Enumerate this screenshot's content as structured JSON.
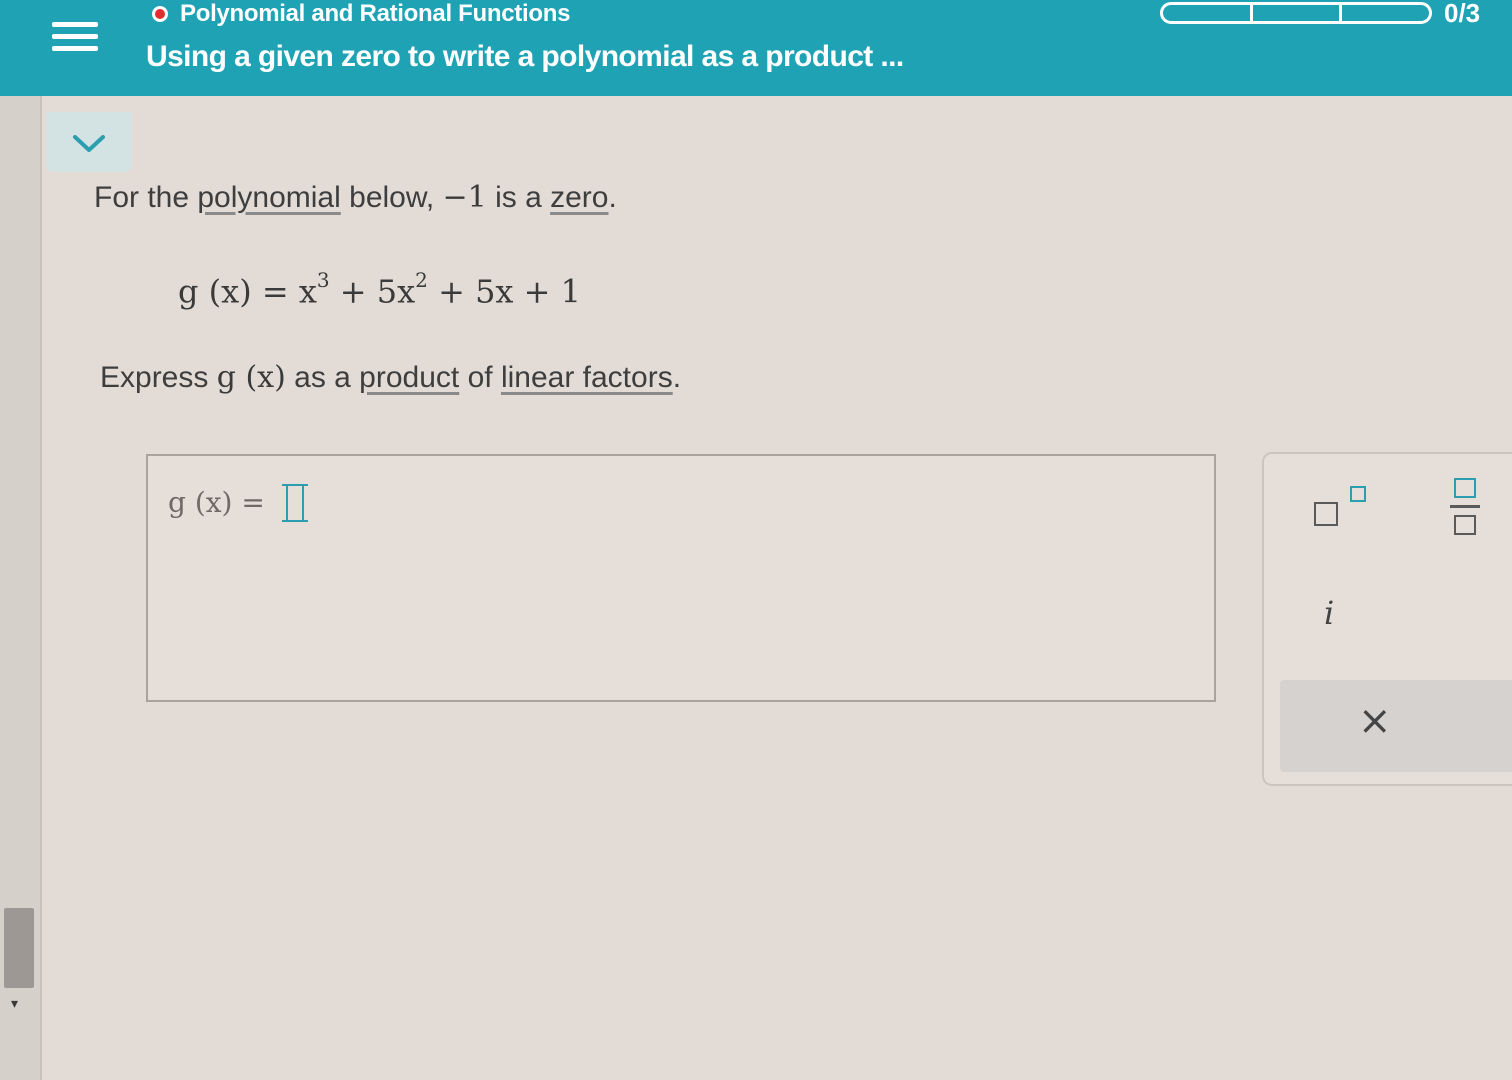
{
  "header": {
    "topic": "Polynomial and Rational Functions",
    "lesson": "Using a given zero to write a polynomial as a product ...",
    "score": "0/3",
    "progress_segments": 3
  },
  "question": {
    "intro_pre": "For the ",
    "intro_link1": "polynomial",
    "intro_mid": " below, ",
    "zero_value": "−1",
    "intro_is_a": " is a ",
    "intro_link2": "zero",
    "intro_end": ".",
    "equation_lhs": "g (x) = x",
    "exp3": "3",
    "term2": "+ 5x",
    "exp2": "2",
    "term3": "+ 5x + 1",
    "instr_pre": "Express ",
    "instr_fn": "g (x)",
    "instr_as_a": " as a ",
    "instr_link1": "product",
    "instr_of": " of ",
    "instr_link2": "linear factors",
    "instr_end": "."
  },
  "answer": {
    "label": "g (x)  =",
    "value": ""
  },
  "keypad": {
    "imag_key": "i",
    "clear_key": "×"
  },
  "colors": {
    "header_bg": "#1fa3b4",
    "accent": "#2b9fb0",
    "status_dot": "#e02d2d"
  },
  "icons": [
    "menu-icon",
    "chevron-down-icon",
    "status-dot-icon",
    "exponent-icon",
    "fraction-icon",
    "close-icon"
  ]
}
